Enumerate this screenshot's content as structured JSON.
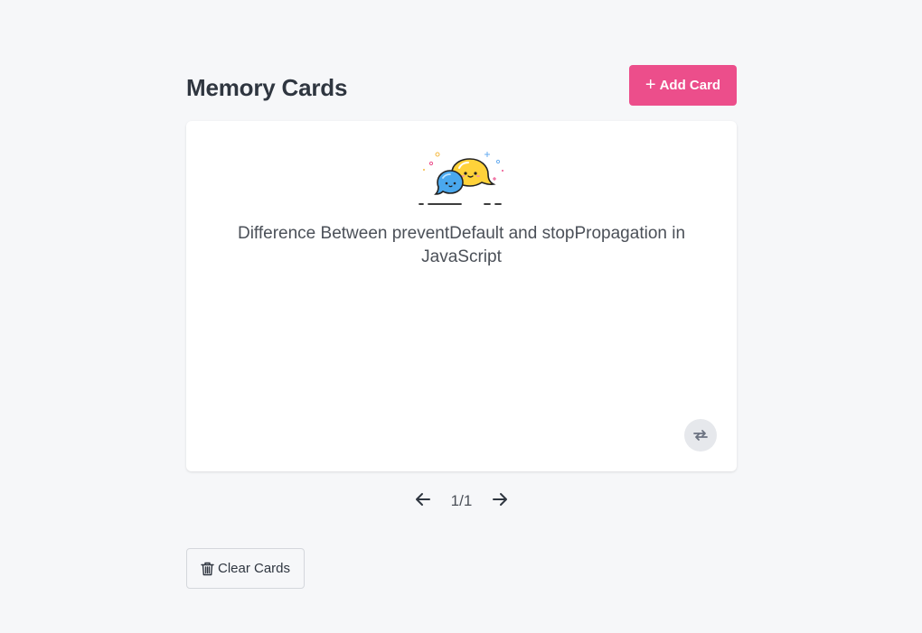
{
  "header": {
    "title": "Memory Cards",
    "add_label": "Add Card",
    "add_icon": "plus-icon"
  },
  "card": {
    "illustration": "chat-bubbles-illustration",
    "question": "Difference Between preventDefault and stopPropagation in JavaScript",
    "flip_icon": "flip-icon"
  },
  "pager": {
    "prev_icon": "arrow-left-icon",
    "next_icon": "arrow-right-icon",
    "count": "1/1"
  },
  "footer": {
    "clear_label": "Clear Cards",
    "clear_icon": "trash-icon"
  },
  "colors": {
    "accent": "#ec4e8b",
    "background": "#f6f7f9",
    "card": "#ffffff"
  }
}
